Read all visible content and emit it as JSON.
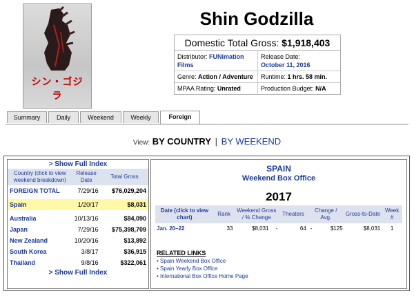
{
  "movie": {
    "title": "Shin Godzilla",
    "poster_text": "シン・ゴジラ",
    "gross_label": "Domestic Total Gross:",
    "gross_value": "$1,918,403",
    "info": [
      [
        {
          "label": "Distributor:",
          "value": "FUNimation Films"
        },
        {
          "label": "Release Date:",
          "value": "October 11, 2016"
        }
      ],
      [
        {
          "label": "Genre:",
          "value": "Action / Adventure"
        },
        {
          "label": "Runtime:",
          "value": "1 hrs. 58 min."
        }
      ],
      [
        {
          "label": "MPAA Rating:",
          "value": "Unrated"
        },
        {
          "label": "Production Budget:",
          "value": "N/A"
        }
      ]
    ]
  },
  "tabs": [
    {
      "label": "Summary"
    },
    {
      "label": "Daily"
    },
    {
      "label": "Weekend"
    },
    {
      "label": "Weekly"
    },
    {
      "label": "Foreign",
      "active": true
    }
  ],
  "view": {
    "label": "View:",
    "selected": "BY COUNTRY",
    "separator": "|",
    "alternate": "BY WEEKEND"
  },
  "countries": {
    "show_index_label": "> Show Full Index",
    "headers": {
      "country": "Country (click to view weekend breakdown)",
      "release": "Release Date",
      "gross": "Total Gross"
    },
    "total": {
      "country": "FOREIGN TOTAL",
      "date": "7/29/16",
      "gross": "$76,029,204"
    },
    "highlighted": {
      "country": "Spain",
      "date": "1/20/17",
      "gross": "$8,031"
    },
    "rows": [
      {
        "country": "Australia",
        "date": "10/13/16",
        "gross": "$84,090"
      },
      {
        "country": "Japan",
        "date": "7/29/16",
        "gross": "$75,398,709"
      },
      {
        "country": "New Zealand",
        "date": "10/20/16",
        "gross": "$13,892"
      },
      {
        "country": "South Korea",
        "date": "3/8/17",
        "gross": "$36,915"
      },
      {
        "country": "Thailand",
        "date": "9/8/16",
        "gross": "$322,061"
      }
    ]
  },
  "detail": {
    "country": "SPAIN",
    "title": "Weekend Box Office",
    "year": "2017",
    "headers": {
      "date": "Date (click to view chart)",
      "rank": "Rank",
      "gross": "Weekend Gross / % Change",
      "theaters": "Theaters",
      "change": "Change / Avg.",
      "gtd": "Gross-to-Date",
      "week": "Week #"
    },
    "rows": [
      {
        "date": "Jan. 20–22",
        "rank": "33",
        "gross": "$8,031",
        "pct": "-",
        "theaters": "64",
        "change": "-",
        "avg": "$125",
        "gtd": "$8,031",
        "week": "1"
      }
    ],
    "related_heading": "RELATED LINKS",
    "related_links": [
      "Spain Weekend Box Office",
      "Spain Yearly Box Office",
      "International Box Office Home Page"
    ]
  }
}
